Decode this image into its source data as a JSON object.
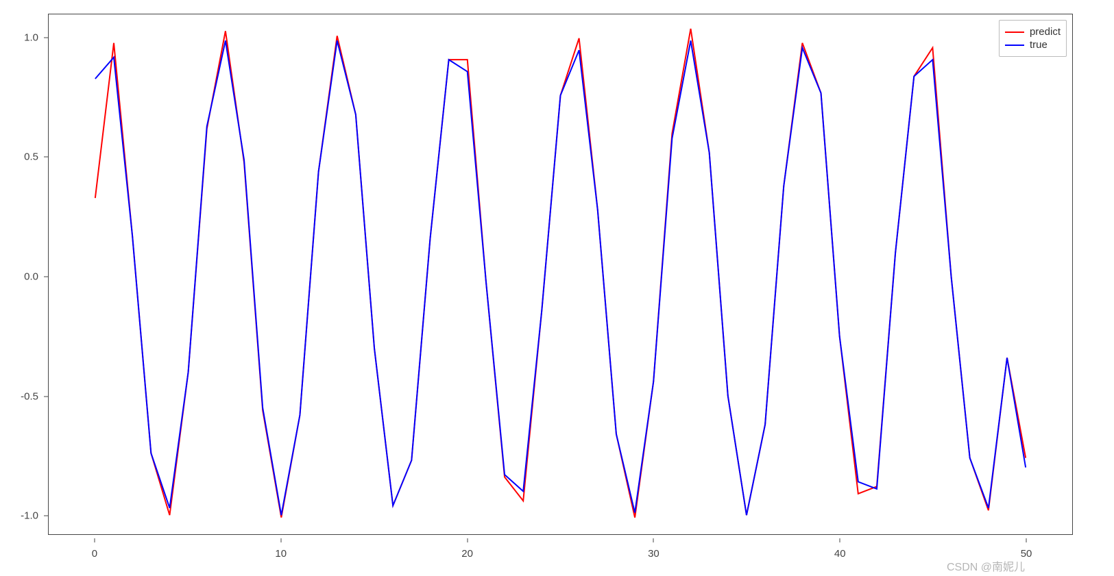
{
  "chart_data": {
    "type": "line",
    "x": [
      0,
      1,
      2,
      3,
      4,
      5,
      6,
      7,
      8,
      9,
      10,
      11,
      12,
      13,
      14,
      15,
      16,
      17,
      18,
      19,
      20,
      21,
      22,
      23,
      24,
      25,
      26,
      27,
      28,
      29,
      30,
      31,
      32,
      33,
      34,
      35,
      36,
      37,
      38,
      39,
      40,
      41,
      42,
      43,
      44,
      45,
      46,
      47,
      48,
      49,
      50
    ],
    "series": [
      {
        "name": "predict",
        "color": "#ff0000",
        "values": [
          0.33,
          0.98,
          0.17,
          -0.74,
          -1.0,
          -0.4,
          0.62,
          1.03,
          0.48,
          -0.56,
          -1.01,
          -0.58,
          0.44,
          1.01,
          0.68,
          -0.3,
          -0.96,
          -0.77,
          0.16,
          0.91,
          0.91,
          -0.02,
          -0.84,
          -0.94,
          -0.14,
          0.76,
          1.0,
          0.28,
          -0.66,
          -1.01,
          -0.44,
          0.6,
          1.04,
          0.52,
          -0.5,
          -1.0,
          -0.62,
          0.38,
          0.98,
          0.77,
          -0.25,
          -0.91,
          -0.88,
          0.1,
          0.84,
          0.96,
          0.0,
          -0.76,
          -0.98,
          -0.34,
          -0.76
        ]
      },
      {
        "name": "true",
        "color": "#0000ff",
        "values": [
          0.83,
          0.92,
          0.17,
          -0.74,
          -0.97,
          -0.4,
          0.63,
          0.99,
          0.49,
          -0.55,
          -1.0,
          -0.58,
          0.44,
          0.99,
          0.68,
          -0.3,
          -0.96,
          -0.77,
          0.16,
          0.91,
          0.86,
          -0.02,
          -0.83,
          -0.9,
          -0.14,
          0.76,
          0.95,
          0.28,
          -0.66,
          -0.99,
          -0.44,
          0.58,
          0.99,
          0.52,
          -0.5,
          -1.0,
          -0.62,
          0.38,
          0.96,
          0.77,
          -0.25,
          -0.86,
          -0.89,
          0.1,
          0.84,
          0.91,
          0.0,
          -0.76,
          -0.97,
          -0.34,
          -0.8
        ]
      }
    ],
    "xlim": [
      -2.5,
      52.5
    ],
    "ylim": [
      -1.08,
      1.1
    ],
    "x_ticks": [
      0,
      10,
      20,
      30,
      40,
      50
    ],
    "y_ticks": [
      -1.0,
      -0.5,
      0.0,
      0.5,
      1.0
    ],
    "xlabel": "",
    "ylabel": "",
    "title": "",
    "legend_position": "upper right"
  },
  "legend": {
    "items": [
      {
        "label": "predict",
        "color": "#ff0000"
      },
      {
        "label": "true",
        "color": "#0000ff"
      }
    ]
  },
  "watermark": "CSDN @南妮儿"
}
